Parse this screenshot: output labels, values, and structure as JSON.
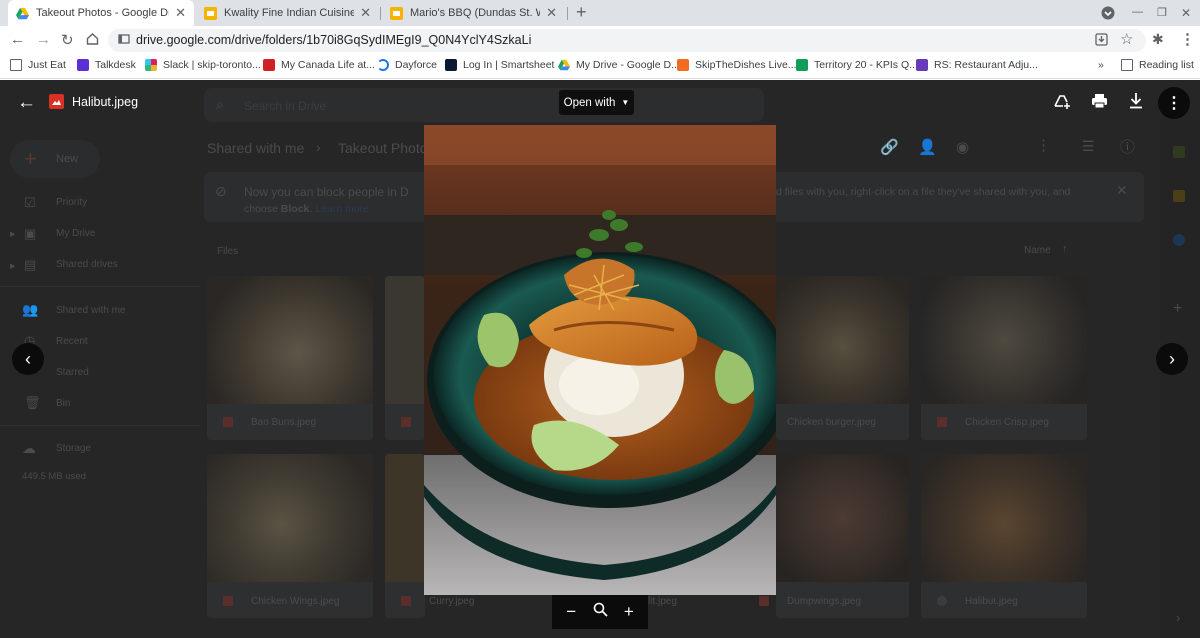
{
  "tabs": [
    {
      "title": "Takeout Photos - Google Drive",
      "icon": "google-drive-icon"
    },
    {
      "title": "Kwality Fine Indian Cuisine (Guel",
      "icon": "google-slides-icon"
    },
    {
      "title": "Mario's BBQ (Dundas St. W) - Bu",
      "icon": "google-slides-icon"
    }
  ],
  "address": {
    "url": "drive.google.com/drive/folders/1b70i8GqSydIMEgI9_Q0N4YclY4SzkaLi"
  },
  "bookmarks": [
    "Just Eat",
    "Talkdesk",
    "Slack | skip-toronto...",
    "My Canada Life at...",
    "Dayforce",
    "Log In | Smartsheet",
    "My Drive - Google D...",
    "SkipTheDishes Live...",
    "Territory 20 - KPIs Q...",
    "RS: Restaurant Adju..."
  ],
  "reading_list": "Reading list",
  "bookmarks_more": "»",
  "drive": {
    "search_placeholder": "Search in Drive",
    "new_label": "New",
    "sidebar": [
      "Priority",
      "My Drive",
      "Shared drives",
      "Shared with me",
      "Recent",
      "Starred",
      "Bin",
      "Storage"
    ],
    "storage_used": "449.5 MB used",
    "breadcrumb": [
      "Shared with me",
      "Takeout Photo"
    ],
    "breadcrumb_sep": "›",
    "banner_left": "Now you can block people in D",
    "banner_left2": "choose",
    "banner_bold": "Block",
    "banner_link": "Learn more",
    "banner_right": "d files with you, right-click on a file they've shared with you, and",
    "files_heading": "Files",
    "sort_label": "Name",
    "files_row1": [
      "Bao Buns.jpeg",
      "Chicken burger.jpeg",
      "Chicken Crisp.jpeg"
    ],
    "files_row2": [
      "Chicken Wings.jpeg",
      "Curry.jpeg",
      "lit.jpeg",
      "Dumpwings.jpeg",
      "Halibut.jpeg"
    ]
  },
  "viewer": {
    "filename": "Halibut.jpeg",
    "open_with": "Open with"
  }
}
